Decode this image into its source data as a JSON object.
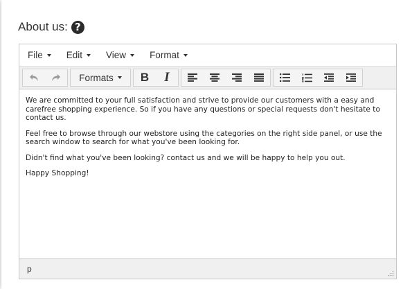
{
  "heading": {
    "label": "About us:",
    "help_icon": "?"
  },
  "menubar": {
    "items": [
      "File",
      "Edit",
      "View",
      "Format"
    ]
  },
  "toolbar": {
    "undo_icon": "undo-icon",
    "redo_icon": "redo-icon",
    "formats_label": "Formats",
    "bold_label": "B",
    "italic_label": "I"
  },
  "content": {
    "paragraphs": [
      "We are committed to your full satisfaction and strive to provide our customers with a easy and carefree shopping experience. So if you have any questions or special requests don't hesitate to contact us.",
      "Feel free to browse through our webstore using the categories on the right side panel, or use the search window to search for what you've been looking for.",
      "Didn't find what you've been looking? contact us and we will be happy to help you out.",
      "Happy Shopping!"
    ]
  },
  "statusbar": {
    "path": "p"
  }
}
